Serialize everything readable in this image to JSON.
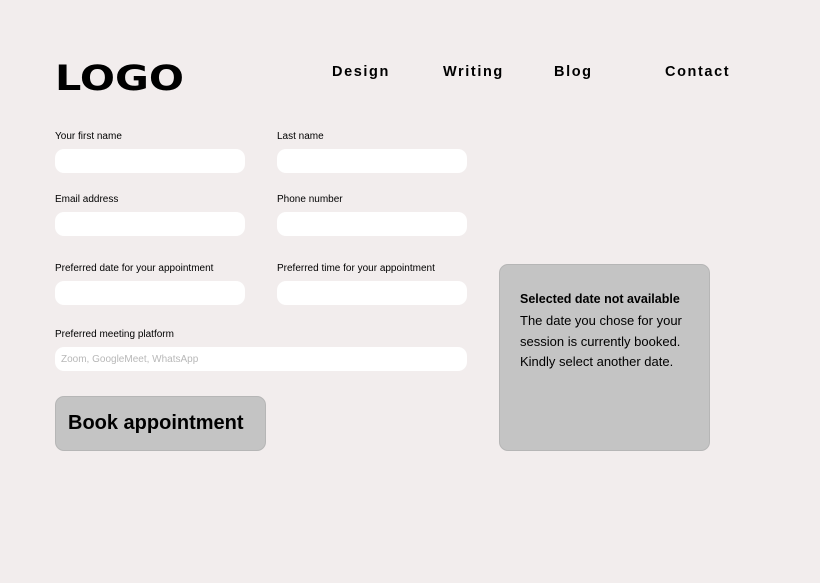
{
  "header": {
    "logo": "LOGO",
    "nav": [
      "Design",
      "Writing",
      "Blog",
      "Contact"
    ]
  },
  "form": {
    "first_name": {
      "label": "Your first name",
      "value": ""
    },
    "last_name": {
      "label": "Last name",
      "value": ""
    },
    "email": {
      "label": "Email address",
      "value": ""
    },
    "phone": {
      "label": "Phone number",
      "value": ""
    },
    "date": {
      "label": "Preferred date for your appointment",
      "value": ""
    },
    "time": {
      "label": "Preferred time for your appointment",
      "value": ""
    },
    "platform": {
      "label": "Preferred meeting platform",
      "placeholder": "Zoom, GoogleMeet, WhatsApp",
      "value": ""
    },
    "submit_label": "Book appointment"
  },
  "alert": {
    "title": "Selected date not available",
    "message": "The date you chose for your session is currently booked.  Kindly select another date."
  },
  "colors": {
    "background": "#f2eded",
    "input_fill": "#ffffff",
    "button_fill": "#c4c4c4",
    "alert_fill": "#c4c4c4"
  }
}
